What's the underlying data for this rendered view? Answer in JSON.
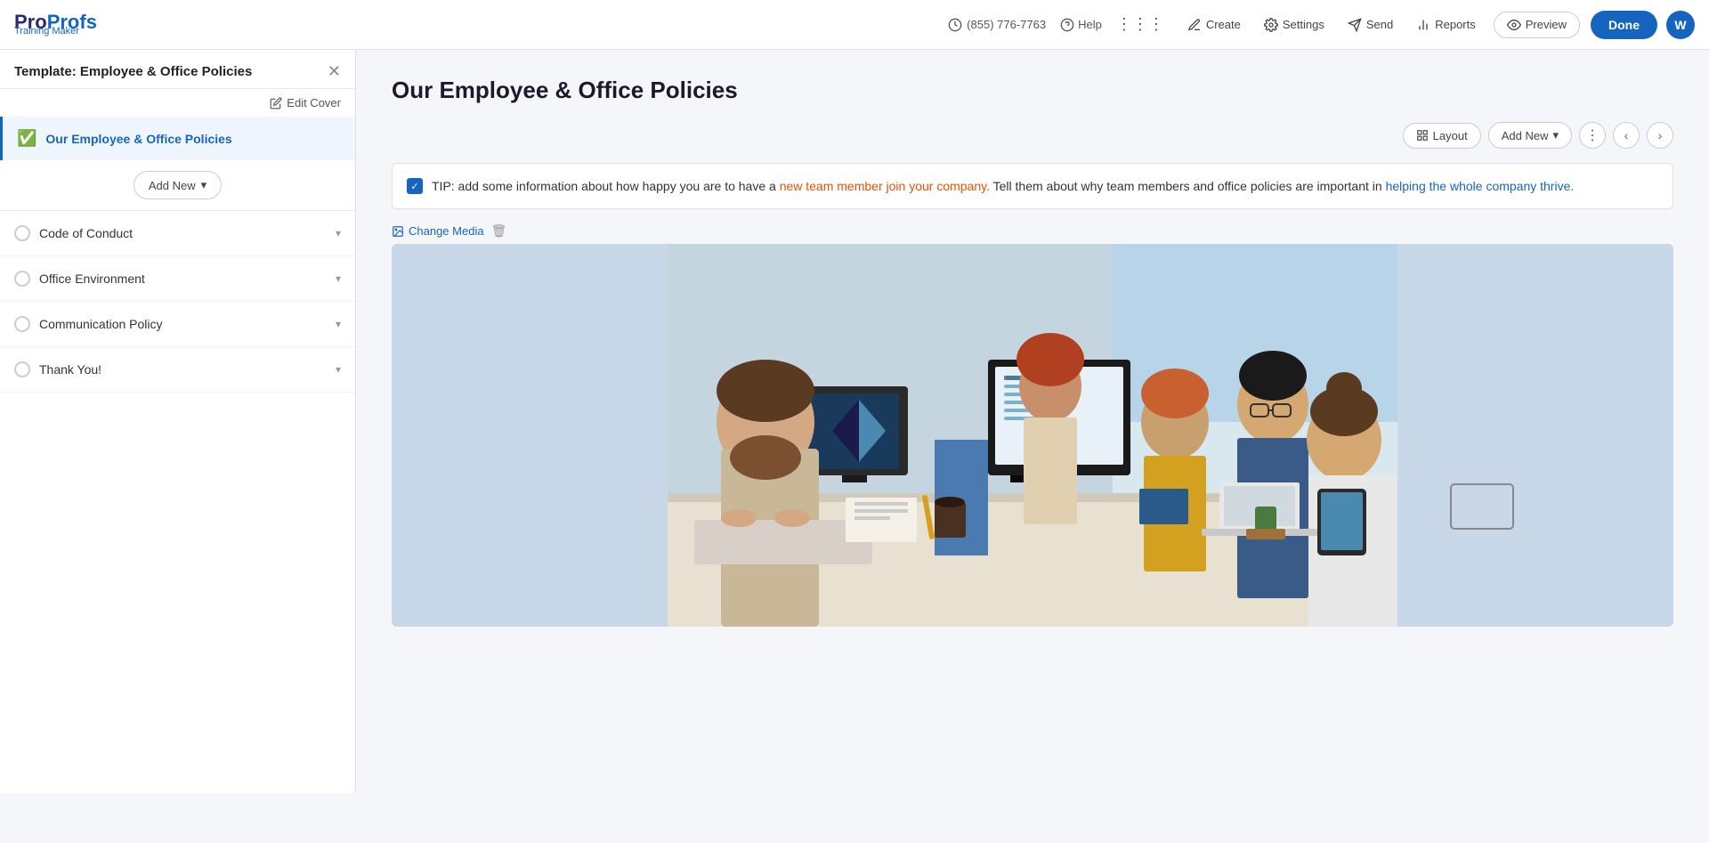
{
  "topbar": {
    "phone": "(855) 776-7763",
    "help_label": "Help",
    "avatar_letter": "W",
    "nav_create": "Create",
    "nav_settings": "Settings",
    "nav_send": "Send",
    "nav_reports": "Reports",
    "btn_preview": "Preview",
    "btn_done": "Done"
  },
  "sidebar": {
    "title": "Template: Employee & Office Policies",
    "edit_cover": "Edit Cover",
    "active_item": {
      "label": "Our Employee & Office Policies"
    },
    "add_new": "Add New",
    "nav_items": [
      {
        "label": "Code of Conduct"
      },
      {
        "label": "Office Environment"
      },
      {
        "label": "Communication Policy"
      },
      {
        "label": "Thank You!"
      }
    ]
  },
  "main": {
    "page_title": "Our Employee & Office Policies",
    "toolbar": {
      "layout_label": "Layout",
      "add_new_label": "Add New"
    },
    "tip": {
      "text_part1": "TIP: add some information about how happy you are to have a new team member join your company. Tell them about why team members and office policies are important in helping the whole company thrive."
    },
    "media": {
      "change_label": "Change Media"
    }
  }
}
